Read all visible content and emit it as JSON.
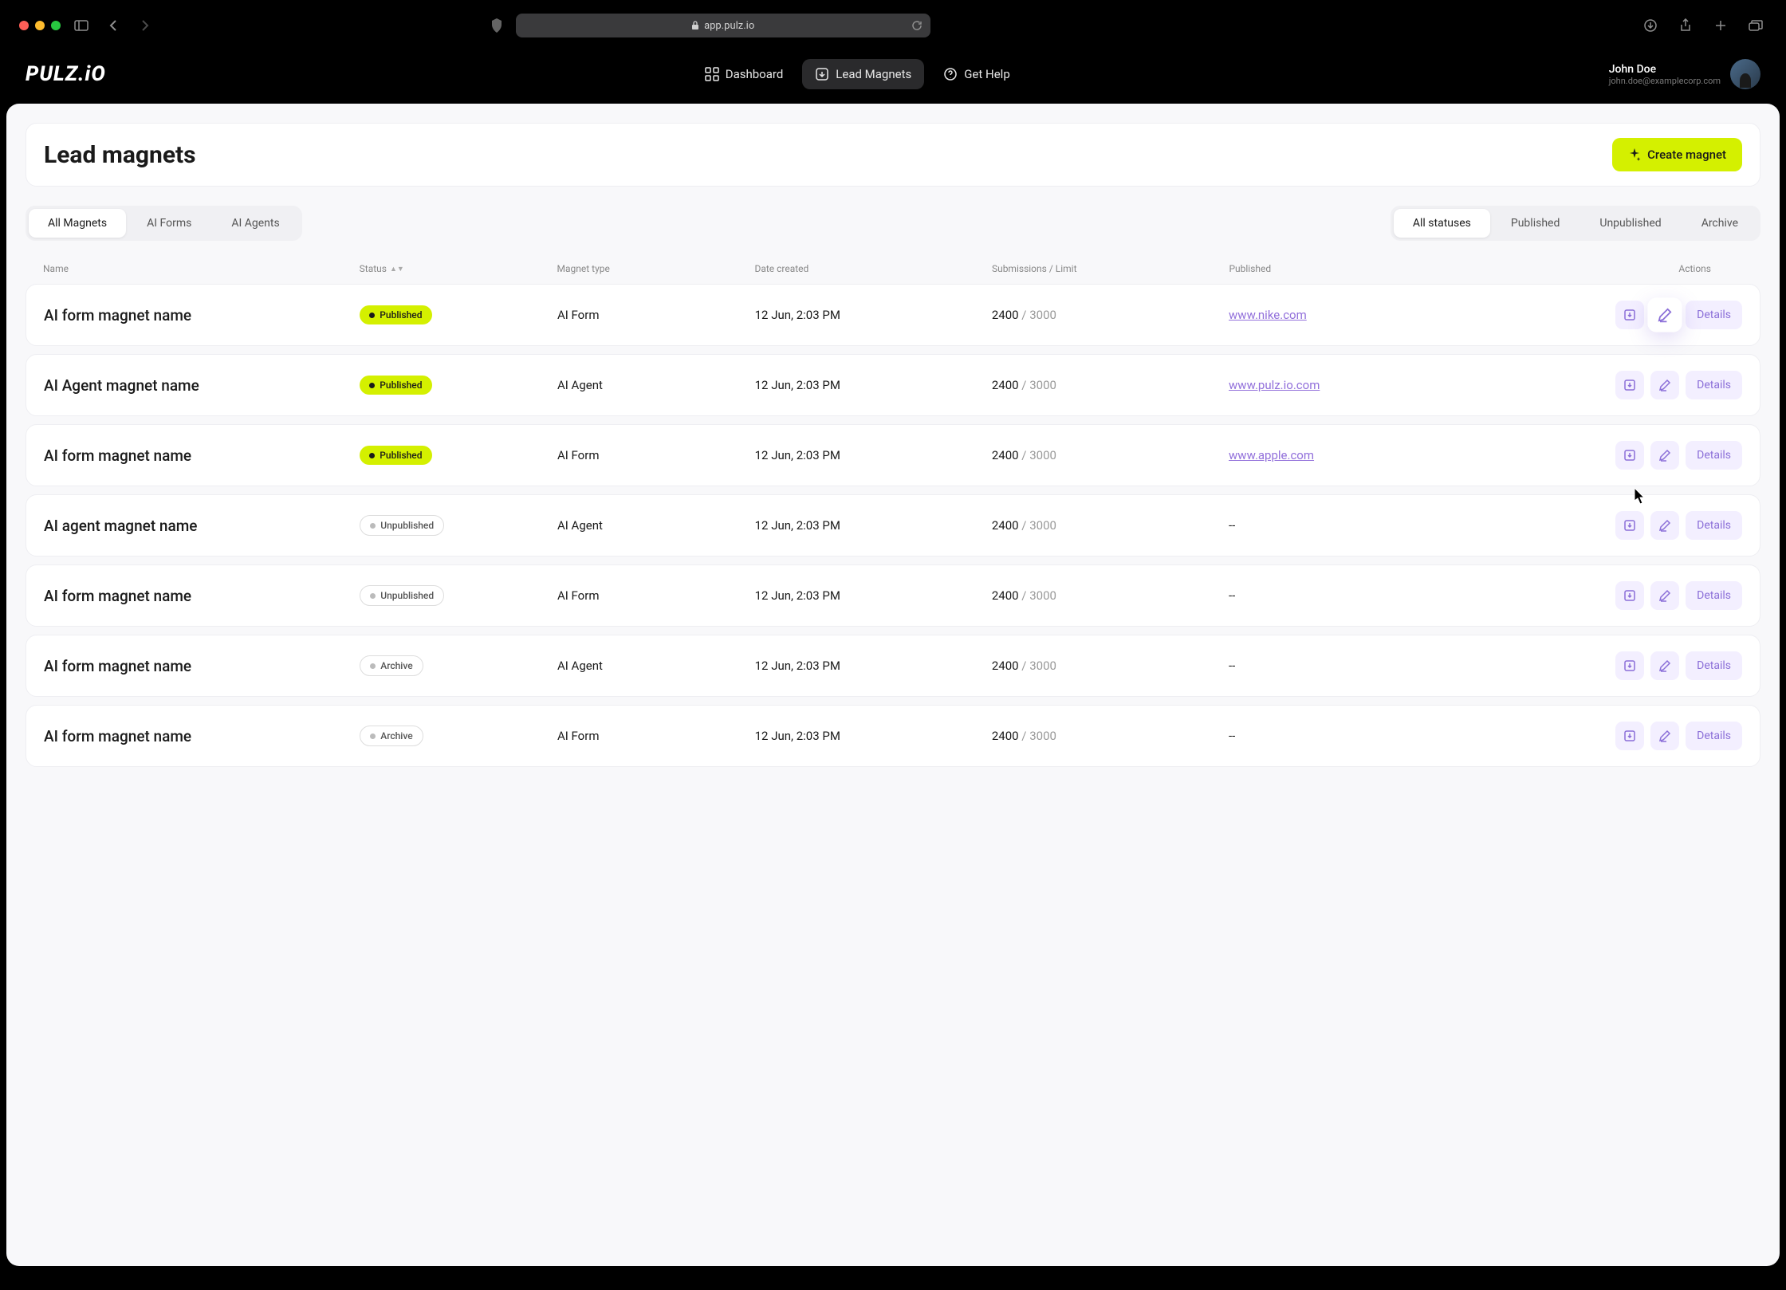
{
  "browser": {
    "url": "app.pulz.io"
  },
  "brand": "PULZ.iO",
  "nav": {
    "dashboard": "Dashboard",
    "lead_magnets": "Lead Magnets",
    "get_help": "Get Help"
  },
  "user": {
    "name": "John Doe",
    "email": "john.doe@examplecorp.com"
  },
  "page": {
    "title": "Lead magnets",
    "create_button": "Create magnet"
  },
  "type_tabs": [
    "All Magnets",
    "AI Forms",
    "AI Agents"
  ],
  "status_tabs": [
    "All statuses",
    "Published",
    "Unpublished",
    "Archive"
  ],
  "columns": {
    "name": "Name",
    "status": "Status",
    "type": "Magnet type",
    "date": "Date created",
    "submissions": "Submissions / Limit",
    "published": "Published",
    "actions": "Actions"
  },
  "status_labels": {
    "published": "Published",
    "unpublished": "Unpublished",
    "archive": "Archive"
  },
  "details_label": "Details",
  "rows": [
    {
      "name": "AI form magnet name",
      "status": "published",
      "type": "AI Form",
      "date": "12 Jun, 2:03 PM",
      "sub_used": "2400",
      "sub_limit": "3000",
      "published": "www.nike.com"
    },
    {
      "name": "AI Agent magnet name",
      "status": "published",
      "type": "AI Agent",
      "date": "12 Jun, 2:03 PM",
      "sub_used": "2400",
      "sub_limit": "3000",
      "published": "www.pulz.io.com"
    },
    {
      "name": "AI form magnet name",
      "status": "published",
      "type": "AI Form",
      "date": "12 Jun, 2:03 PM",
      "sub_used": "2400",
      "sub_limit": "3000",
      "published": "www.apple.com"
    },
    {
      "name": "AI agent magnet name",
      "status": "unpublished",
      "type": "AI Agent",
      "date": "12 Jun, 2:03 PM",
      "sub_used": "2400",
      "sub_limit": "3000",
      "published": "--"
    },
    {
      "name": "AI form magnet name",
      "status": "unpublished",
      "type": "AI Form",
      "date": "12 Jun, 2:03 PM",
      "sub_used": "2400",
      "sub_limit": "3000",
      "published": "--"
    },
    {
      "name": "AI form magnet name",
      "status": "archive",
      "type": "AI Agent",
      "date": "12 Jun, 2:03 PM",
      "sub_used": "2400",
      "sub_limit": "3000",
      "published": "--"
    },
    {
      "name": "AI form magnet name",
      "status": "archive",
      "type": "AI Form",
      "date": "12 Jun, 2:03 PM",
      "sub_used": "2400",
      "sub_limit": "3000",
      "published": "--"
    }
  ]
}
